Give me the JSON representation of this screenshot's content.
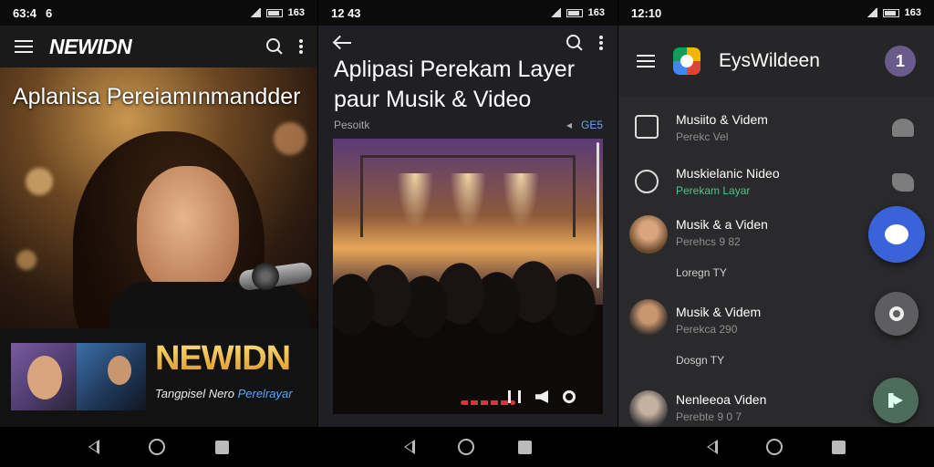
{
  "panel1": {
    "status": {
      "time": "63:4",
      "extra": "6",
      "battery": "163"
    },
    "brand": "NEWIDN",
    "hero_title": "Aplanisa Pereiamınmandder",
    "banner": {
      "logo": "NEWIDN",
      "subtitle_white": "Tangpisel Nero",
      "subtitle_blue": "Perelrayar"
    }
  },
  "panel2": {
    "status": {
      "time": "12 43",
      "battery": "163"
    },
    "title_line1": "Aplipasi Perekam Layer",
    "title_line2": "paur Musik & Video",
    "meta_left": "Pesoitk",
    "meta_badge": "GE5"
  },
  "panel3": {
    "status": {
      "time": "12:10",
      "battery": "163"
    },
    "brand": "EysWildeen",
    "avatar_initial": "1",
    "items": [
      {
        "title": "Musiito & Videm",
        "sub": "Perekc Vel",
        "icon": "download-icon",
        "right_icon": "people-icon"
      },
      {
        "title": "Muskielanic Nideo",
        "sub": "Perekam Layar",
        "icon": "record-disc-icon",
        "right_icon": "tag-icon"
      },
      {
        "title": "Musik & a Viden",
        "sub": "Perehcs 9 82",
        "extra": "Loregn TY",
        "avatar": "woman-avatar"
      },
      {
        "title": "Musik & Videm",
        "sub": "Perekca 290",
        "extra": "Dosgn TY",
        "avatar": "man-avatar"
      },
      {
        "title": "Nenleeoa Viden",
        "sub": "Perebte 9 0 7",
        "avatar": "person-avatar"
      }
    ]
  },
  "colors": {
    "accent_blue": "#3b63d9",
    "accent_green": "#4cc38a",
    "banner_gold": "#f0c040",
    "progress_red": "#e2303a"
  }
}
